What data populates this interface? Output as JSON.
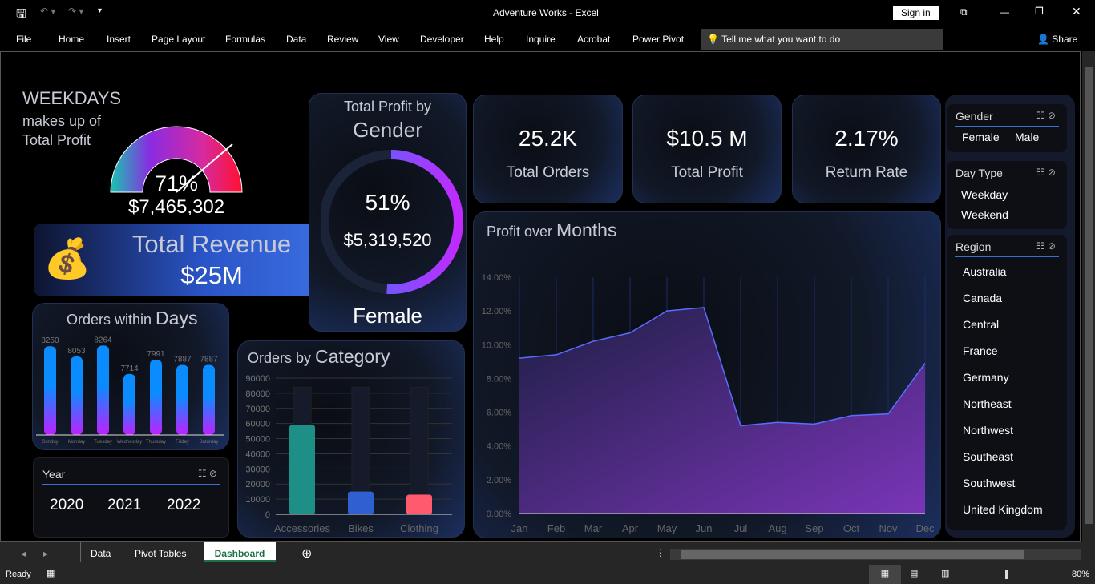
{
  "title": "Adventure Works  -  Excel",
  "sign_in": "Sign in",
  "ribbon": [
    "File",
    "Home",
    "Insert",
    "Page Layout",
    "Formulas",
    "Data",
    "Review",
    "View",
    "Developer",
    "Help",
    "Inquire",
    "Acrobat",
    "Power Pivot"
  ],
  "tell_me": "Tell me what you want to do",
  "share": "Share",
  "weekdays": {
    "title": "WEEKDAYS",
    "sub1": "makes up of",
    "sub2": "Total Profit",
    "percent": "71%",
    "value": "$7,465,302",
    "fraction": 0.71
  },
  "revenue": {
    "label": "Total Revenue",
    "value": "$25M"
  },
  "gender_card": {
    "title1": "Total Profit by",
    "title2": "Gender",
    "percent": "51%",
    "value": "$5,319,520",
    "label": "Female",
    "fraction": 0.51
  },
  "kpis": [
    {
      "value": "25.2K",
      "label": "Total Orders"
    },
    {
      "value": "$10.5 M",
      "label": "Total Profit"
    },
    {
      "value": "2.17%",
      "label": "Return Rate"
    }
  ],
  "days_chart": {
    "title1": "Orders within ",
    "title2": "Days"
  },
  "category_chart": {
    "title1": "Orders by ",
    "title2": "Category"
  },
  "months_chart": {
    "title1": "Profit over ",
    "title2": "Months"
  },
  "year_slicer": {
    "header": "Year",
    "items": [
      "2020",
      "2021",
      "2022"
    ]
  },
  "slicers": {
    "gender": {
      "header": "Gender",
      "items": [
        "Female",
        "Male"
      ]
    },
    "daytype": {
      "header": "Day Type",
      "items": [
        "Weekday",
        "Weekend"
      ]
    },
    "region": {
      "header": "Region",
      "items": [
        "Australia",
        "Canada",
        "Central",
        "France",
        "Germany",
        "Northeast",
        "Northwest",
        "Southeast",
        "Southwest",
        "United Kingdom"
      ]
    }
  },
  "sheet_tabs": [
    "Data",
    "Pivot Tables",
    "Dashboard"
  ],
  "status": {
    "ready": "Ready",
    "zoom": "80%"
  },
  "chart_data": [
    {
      "type": "bar",
      "title": "Orders within Days",
      "categories": [
        "Sunday",
        "Monday",
        "Tuesday",
        "Wednesday",
        "Thursday",
        "Friday",
        "Saturday"
      ],
      "values": [
        8250,
        8053,
        8264,
        7714,
        7991,
        7887,
        7887
      ]
    },
    {
      "type": "bar",
      "title": "Orders by Category",
      "categories": [
        "Accessories",
        "Bikes",
        "Clothing"
      ],
      "values": [
        59000,
        15000,
        13000
      ],
      "ylim": [
        0,
        90000
      ],
      "yticks": [
        "0",
        "10000",
        "20000",
        "30000",
        "40000",
        "50000",
        "60000",
        "70000",
        "80000",
        "90000"
      ],
      "colors": [
        "#1e8f86",
        "#2f5fd0",
        "#ff5a6e"
      ]
    },
    {
      "type": "area",
      "title": "Profit over Months",
      "categories": [
        "Jan",
        "Feb",
        "Mar",
        "Apr",
        "May",
        "Jun",
        "Jul",
        "Aug",
        "Sep",
        "Oct",
        "Nov",
        "Dec"
      ],
      "values": [
        9.2,
        9.4,
        10.2,
        10.7,
        12.0,
        12.2,
        5.2,
        5.4,
        5.3,
        5.8,
        5.9,
        8.9
      ],
      "ylim": [
        0,
        14
      ],
      "yticks": [
        "0.00%",
        "2.00%",
        "4.00%",
        "6.00%",
        "8.00%",
        "10.00%",
        "12.00%",
        "14.00%"
      ]
    }
  ]
}
